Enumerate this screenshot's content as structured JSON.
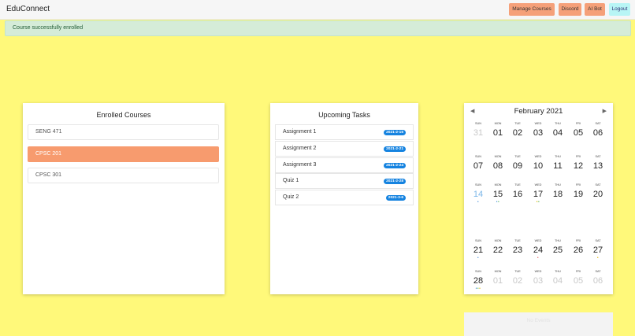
{
  "nav": {
    "brand": "EduConnect",
    "buttons": [
      "Manage Courses",
      "Discord",
      "AI Bot",
      "Logout"
    ]
  },
  "alert": {
    "message": "Course successfully enrolled"
  },
  "courses": {
    "title": "Enrolled Courses",
    "items": [
      "SENG 471",
      "CPSC 201",
      "CPSC 301"
    ],
    "selected": "CPSC 201"
  },
  "tasks": {
    "title": "Upcoming Tasks",
    "items": [
      {
        "name": "Assignment 1",
        "date": "2021-2-15"
      },
      {
        "name": "Assignment 2",
        "date": "2021-2-21"
      },
      {
        "name": "Assignment 3",
        "date": "2021-2-24"
      },
      {
        "name": "Quiz 1",
        "date": "2021-2-28"
      },
      {
        "name": "Quiz 2",
        "date": "2021-3-6"
      }
    ]
  },
  "calendar": {
    "month_label": "February 2021",
    "prev_icon": "caret-left-icon",
    "next_icon": "caret-right-icon",
    "weekdays": [
      "SUN",
      "MON",
      "TUE",
      "WED",
      "THU",
      "FRI",
      "SAT"
    ],
    "no_events_text": "No Events",
    "colors": {
      "today": "#7ab6e8",
      "dot_blue": "#4a8fd8",
      "dot_green": "#5cba5c",
      "dot_yellow": "#e0b400",
      "dot_red": "#e06060"
    },
    "weeks": [
      [
        "31",
        "01",
        "02",
        "03",
        "04",
        "05",
        "06"
      ],
      [
        "07",
        "08",
        "09",
        "10",
        "11",
        "12",
        "13"
      ],
      [
        "14",
        "15",
        "16",
        "17",
        "18",
        "19",
        "20"
      ],
      [
        "21",
        "22",
        "23",
        "24",
        "25",
        "26",
        "27"
      ],
      [
        "28",
        "01",
        "02",
        "03",
        "04",
        "05",
        "06"
      ]
    ]
  }
}
